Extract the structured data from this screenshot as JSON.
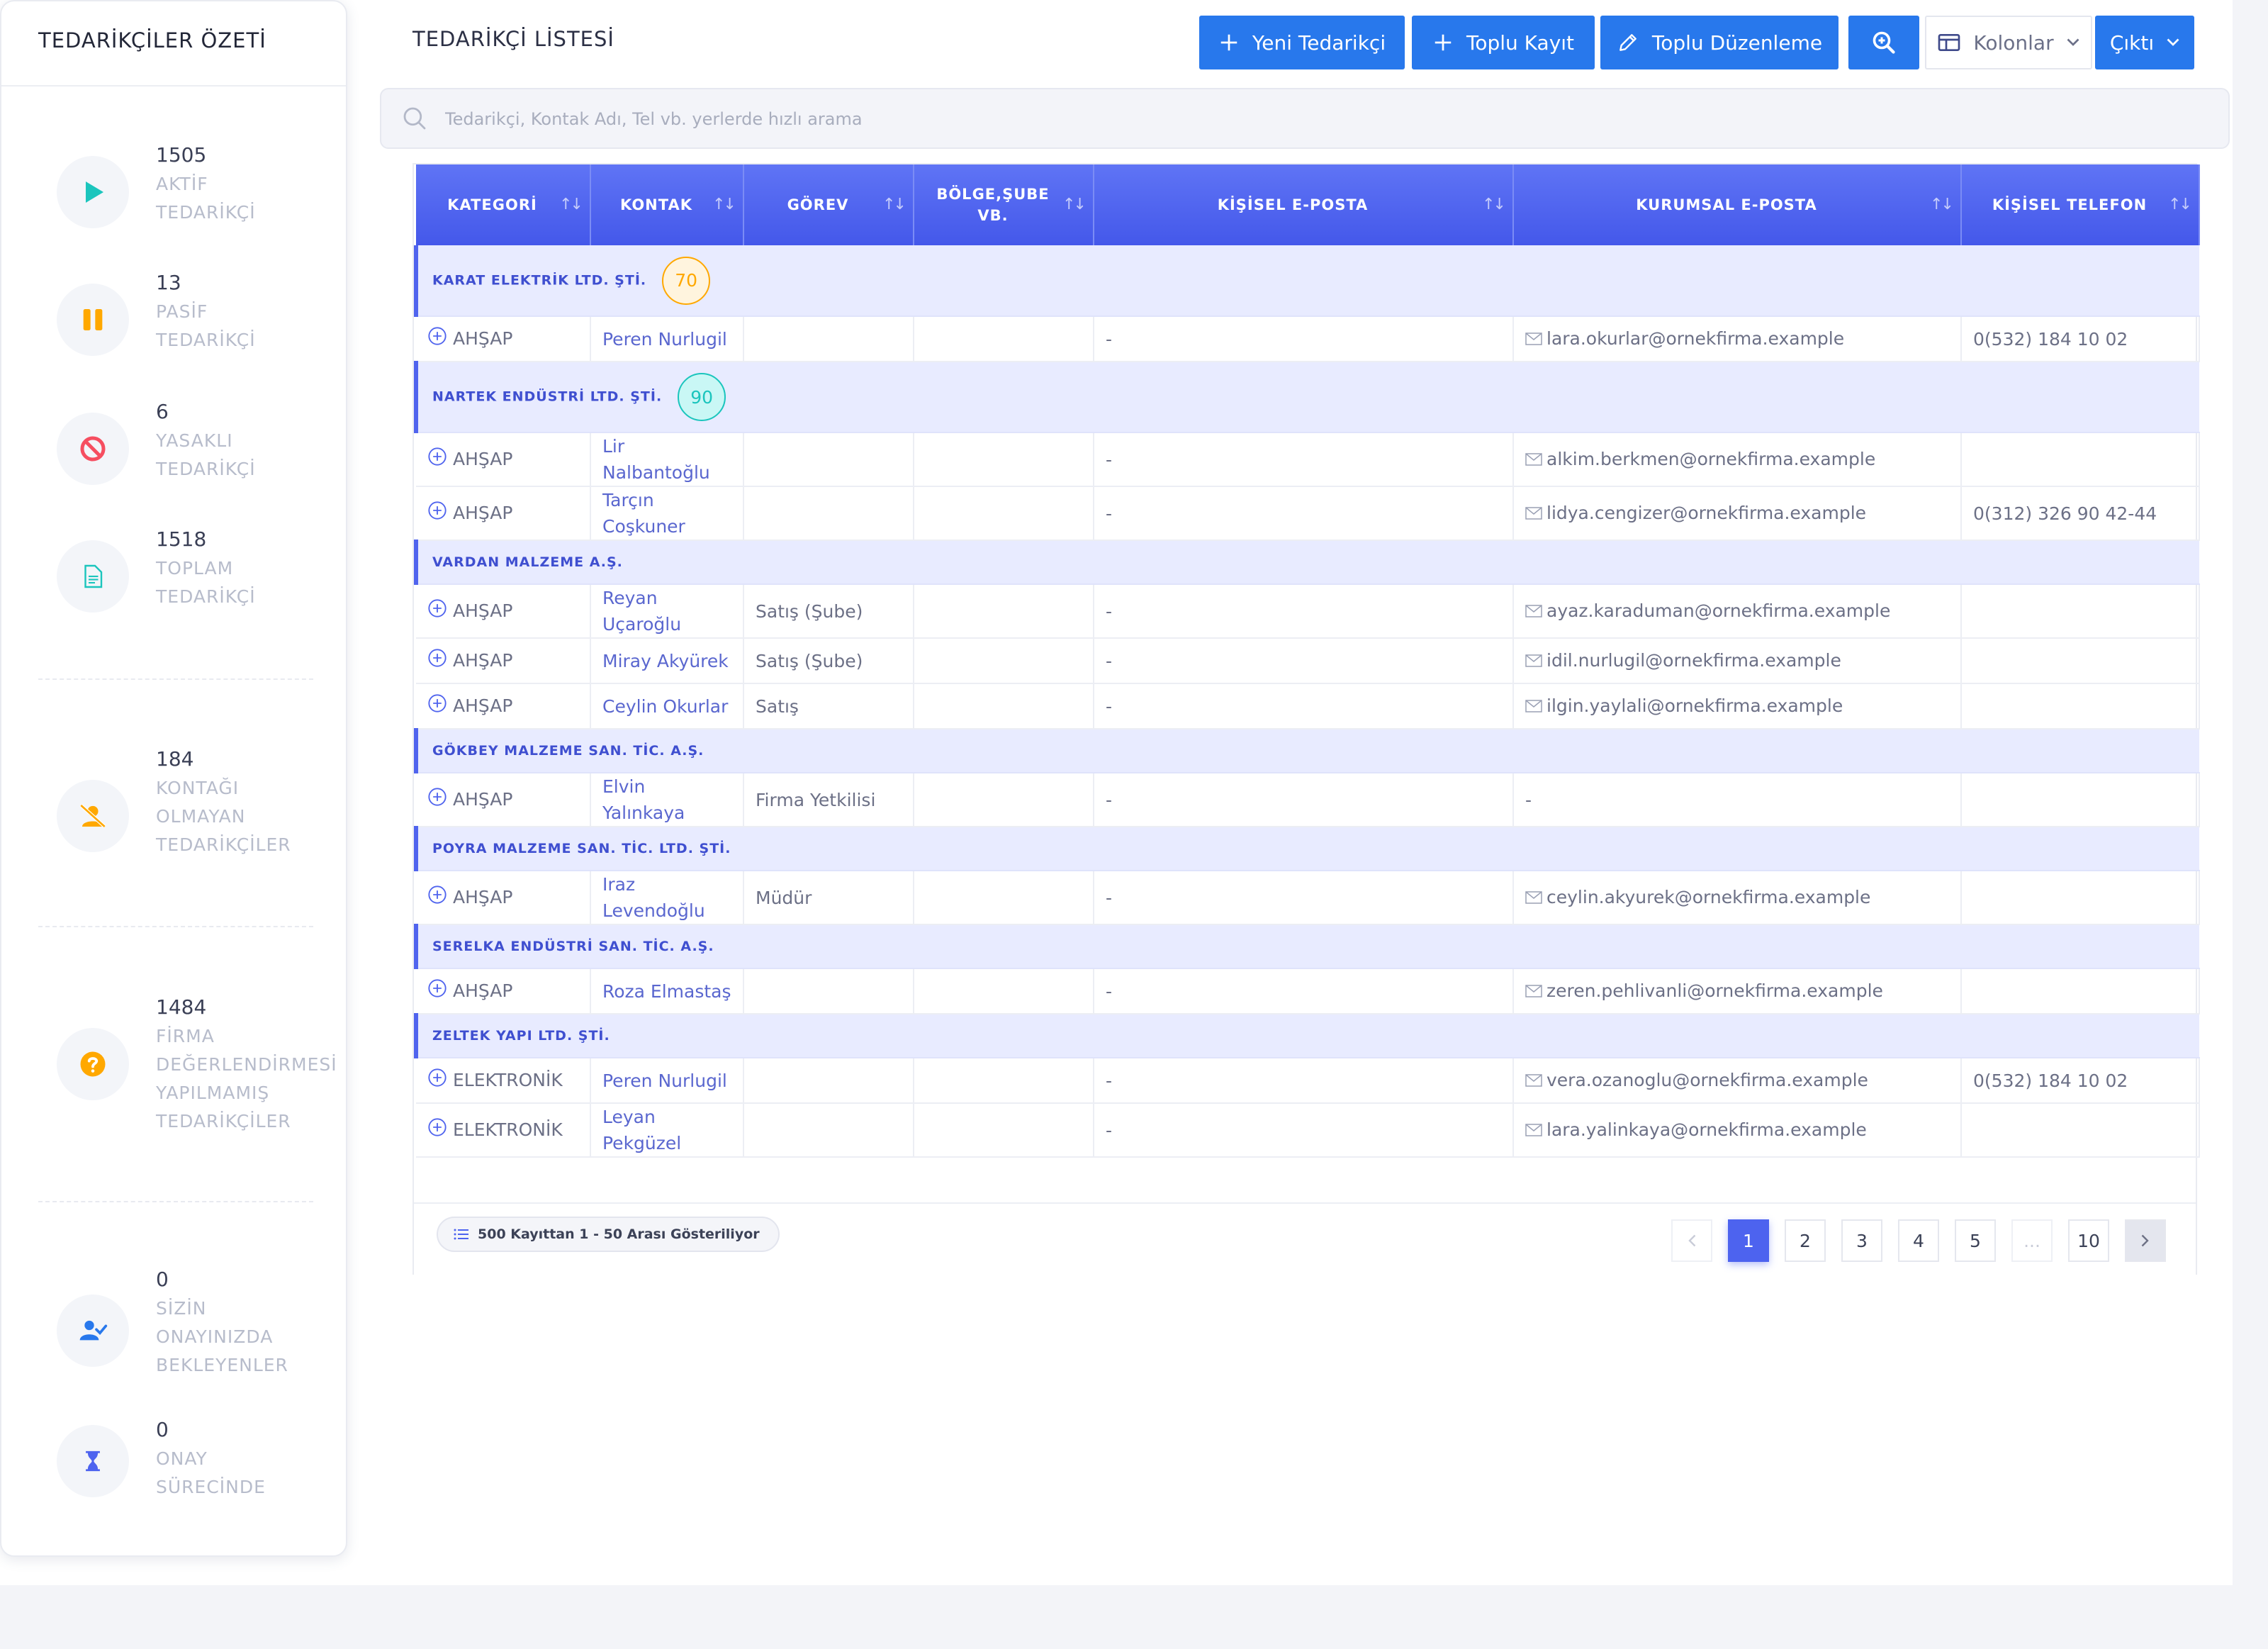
{
  "sidebar": {
    "title": "TEDARİKÇİLER ÖZETİ",
    "stats": [
      {
        "value": "1505",
        "label": "AKTİF\nTEDARİKÇİ",
        "icon": "play-icon",
        "color": "#1bc5bd"
      },
      {
        "value": "13",
        "label": "PASİF\nTEDARİKÇİ",
        "icon": "pause-icon",
        "color": "#ffa800"
      },
      {
        "value": "6",
        "label": "YASAKLI\nTEDARİKÇİ",
        "icon": "ban-icon",
        "color": "#f64e60"
      },
      {
        "value": "1518",
        "label": "TOPLAM\nTEDARİKÇİ",
        "icon": "document-icon",
        "color": "#1bc5bd"
      },
      {
        "value": "184",
        "label": "KONTAĞI\nOLMAYAN\nTEDARİKÇİLER",
        "icon": "user-slash-icon",
        "color": "#ffa800"
      },
      {
        "value": "1484",
        "label": "FİRMA\nDEĞERLENDİRMESİ\nYAPILMAMIŞ\nTEDARİKÇİLER",
        "icon": "question-icon",
        "color": "#ffa800"
      },
      {
        "value": "0",
        "label": "SİZİN\nONAYINIZDA\nBEKLEYENLER",
        "icon": "user-check-icon",
        "color": "#2878ec"
      },
      {
        "value": "0",
        "label": "ONAY\nSÜRECİNDE",
        "icon": "hourglass-icon",
        "color": "#4d63ef"
      }
    ]
  },
  "main": {
    "title": "TEDARİKÇİ LİSTESİ",
    "toolbar": {
      "new_label": "Yeni Tedarikçi",
      "bulk_add_label": "Toplu Kayıt",
      "bulk_edit_label": "Toplu Düzenleme",
      "columns_label": "Kolonlar",
      "export_label": "Çıktı"
    },
    "search": {
      "placeholder": "Tedarikçi, Kontak Adı, Tel vb. yerlerde hızlı arama"
    }
  },
  "table": {
    "headers": [
      "KATEGORİ",
      "KONTAK",
      "GÖREV",
      "BÖLGE,ŞUBE VB.",
      "KİŞİSEL E-POSTA",
      "KURUMSAL E-POSTA",
      "KİŞİSEL TELEFON"
    ],
    "groups": [
      {
        "name": "KARAT ELEKTRİK LTD. ŞTİ.",
        "score": "70",
        "score_color": "#ffa800",
        "score_bg": "#fff4de",
        "rows": [
          {
            "category": "AHŞAP",
            "contact": "Peren Nurlugil",
            "role": "",
            "region": "",
            "personal_email": "-",
            "corporate_email": "lara.okurlar@ornekfirma.example",
            "phone": "0(532) 184 10 02"
          }
        ]
      },
      {
        "name": "NARTEK ENDÜSTRİ LTD. ŞTİ.",
        "score": "90",
        "score_color": "#1bc5bd",
        "score_bg": "#c9f7f5",
        "rows": [
          {
            "category": "AHŞAP",
            "contact": "Lir Nalbantoğlu",
            "role": "",
            "region": "",
            "personal_email": "-",
            "corporate_email": "alkim.berkmen@ornekfirma.example",
            "phone": ""
          },
          {
            "category": "AHŞAP",
            "contact": "Tarçın Coşkuner",
            "role": "",
            "region": "",
            "personal_email": "-",
            "corporate_email": "lidya.cengizer@ornekfirma.example",
            "phone": "0(312) 326 90 42-44"
          }
        ]
      },
      {
        "name": "VARDAN MALZEME A.Ş.",
        "score": "",
        "rows": [
          {
            "category": "AHŞAP",
            "contact": "Reyan Uçaroğlu",
            "role": "Satış (Şube)",
            "region": "",
            "personal_email": "-",
            "corporate_email": "ayaz.karaduman@ornekfirma.example",
            "phone": ""
          },
          {
            "category": "AHŞAP",
            "contact": "Miray Akyürek",
            "role": "Satış (Şube)",
            "region": "",
            "personal_email": "-",
            "corporate_email": "idil.nurlugil@ornekfirma.example",
            "phone": ""
          },
          {
            "category": "AHŞAP",
            "contact": "Ceylin Okurlar",
            "role": "Satış",
            "region": "",
            "personal_email": "-",
            "corporate_email": "ilgin.yaylali@ornekfirma.example",
            "phone": ""
          }
        ]
      },
      {
        "name": "GÖKBEY MALZEME SAN. TİC. A.Ş.",
        "score": "",
        "rows": [
          {
            "category": "AHŞAP",
            "contact": "Elvin Yalınkaya",
            "role": "Firma Yetkilisi",
            "region": "",
            "personal_email": "-",
            "corporate_email": "-",
            "phone": ""
          }
        ]
      },
      {
        "name": "POYRA MALZEME SAN. TİC. LTD. ŞTİ.",
        "score": "",
        "rows": [
          {
            "category": "AHŞAP",
            "contact": "Iraz Levendoğlu",
            "role": "Müdür",
            "region": "",
            "personal_email": "-",
            "corporate_email": "ceylin.akyurek@ornekfirma.example",
            "phone": ""
          }
        ]
      },
      {
        "name": "SERELKA ENDÜSTRİ SAN. TİC. A.Ş.",
        "score": "",
        "rows": [
          {
            "category": "AHŞAP",
            "contact": "Roza Elmastaş",
            "role": "",
            "region": "",
            "personal_email": "-",
            "corporate_email": "zeren.pehlivanli@ornekfirma.example",
            "phone": ""
          }
        ]
      },
      {
        "name": "ZELTEK YAPI LTD. ŞTİ.",
        "score": "",
        "rows": [
          {
            "category": "ELEKTRONİK",
            "contact": "Peren Nurlugil",
            "role": "",
            "region": "",
            "personal_email": "-",
            "corporate_email": "vera.ozanoglu@ornekfirma.example",
            "phone": "0(532) 184 10 02"
          },
          {
            "category": "ELEKTRONİK",
            "contact": "Leyan Pekgüzel",
            "role": "",
            "region": "",
            "personal_email": "-",
            "corporate_email": "lara.yalinkaya@ornekfirma.example",
            "phone": ""
          }
        ]
      }
    ]
  },
  "footer": {
    "records_info": "500 Kayıttan 1 - 50 Arası Gösteriliyor",
    "pages": [
      "1",
      "2",
      "3",
      "4",
      "5",
      "...",
      "10"
    ],
    "current_page": "1"
  },
  "colors": {
    "accent": "#2878ec",
    "header_gradient": "#4d63ef",
    "group_row": "#e8ebff"
  }
}
